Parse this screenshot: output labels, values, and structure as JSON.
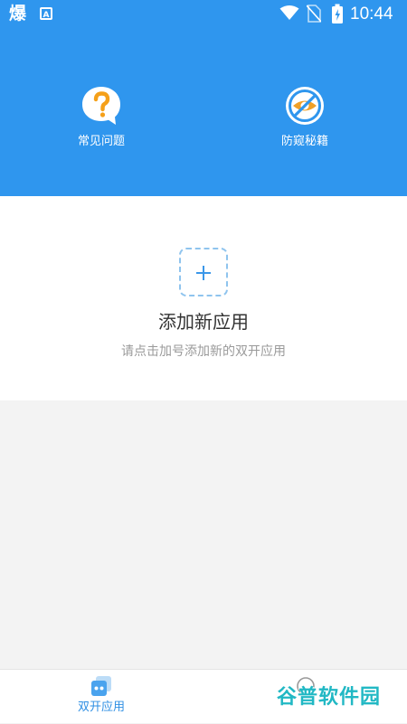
{
  "status_bar": {
    "left_icon_1": "爆",
    "left_icon_2": "A",
    "time": "10:44",
    "icons": [
      "wifi-icon",
      "no-sim-icon",
      "battery-charging-icon"
    ]
  },
  "header": {
    "items": [
      {
        "label": "常见问题",
        "icon": "question-bubble-icon"
      },
      {
        "label": "防窥秘籍",
        "icon": "eye-blocked-icon"
      }
    ]
  },
  "empty_state": {
    "title": "添加新应用",
    "subtitle": "请点击加号添加新的双开应用"
  },
  "bottom_nav": {
    "tabs": [
      {
        "label": "双开应用",
        "icon": "dual-apps-icon",
        "active": true
      }
    ]
  },
  "watermark": {
    "text": "谷普软件园"
  },
  "colors": {
    "primary": "#2f96ee",
    "question_icon": "#f5a019",
    "eye_icon": "#f0a028",
    "accent_text": "#2f8fe3",
    "dashed_border": "#8fc4ee"
  }
}
